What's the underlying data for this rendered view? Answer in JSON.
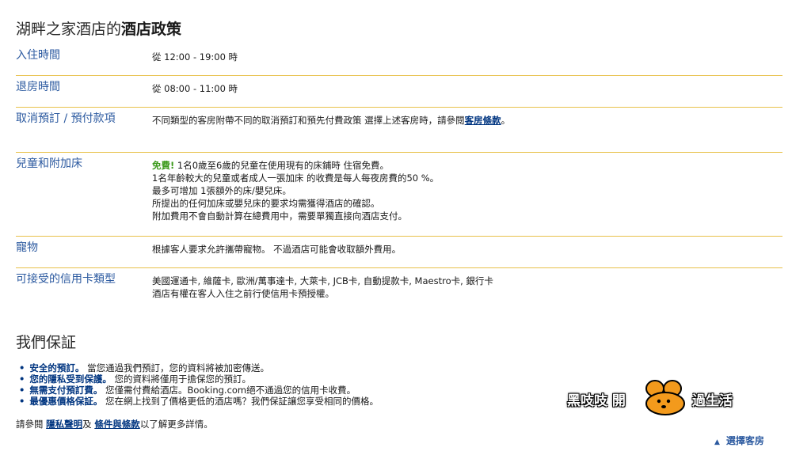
{
  "header": {
    "hotel_name": "湖畔之家酒店的",
    "title_bold": "酒店政策"
  },
  "policies": {
    "checkin": {
      "label": "入住時間",
      "value": "從 12:00 - 19:00 時"
    },
    "checkout": {
      "label": "退房時間",
      "value": "從 08:00 - 11:00 時"
    },
    "cancellation": {
      "label": "取消預訂 / 預付款項",
      "text": "不同類型的客房附帶不同的取消預訂和預先付費政策 選擇上述客房時，請參閱",
      "link": "客房條款",
      "suffix": "。"
    },
    "children": {
      "label": "兒童和附加床",
      "free": "免費!",
      "lines": [
        "1名0歲至6歲的兒童在使用現有的床鋪時 住宿免費。",
        "1名年齡較大的兒童或者成人一張加床 的收費是每人每夜房費的50 %。",
        "最多可增加 1張額外的床/嬰兒床。",
        "所提出的任何加床或嬰兒床的要求均需獲得酒店的確認。",
        "附加費用不會自動計算在總費用中，需要單獨直接向酒店支付。"
      ]
    },
    "pets": {
      "label": "寵物",
      "value": "根據客人要求允許攜帶寵物。 不過酒店可能會收取額外費用。"
    },
    "cards": {
      "label": "可接受的信用卡類型",
      "lines": [
        "美國運通卡, 維薩卡, 歐洲/萬事達卡, 大萊卡, JCB卡, 自動提款卡, Maestro卡, 銀行卡",
        "酒店有權在客人入住之前行使信用卡預授權。"
      ]
    }
  },
  "guarantee": {
    "title": "我們保証",
    "items": [
      {
        "bold": "安全的預訂。",
        "text": " 當您通過我們預訂，您的資料將被加密傳送。"
      },
      {
        "bold": "您的隱私受到保護。",
        "text": " 您的資料將僅用于擔保您的預訂。"
      },
      {
        "bold": "無需支付預訂費。",
        "text": " 您僅需付費給酒店。Booking.com絕不通過您的信用卡收費。"
      },
      {
        "bold": "最優惠價格保証。",
        "text": " 您在網上找到了價格更低的酒店嗎？我們保証讓您享受相同的價格。"
      }
    ]
  },
  "footer": {
    "prefix": "請參閱 ",
    "privacy_link": "隱私聲明",
    "mid": "及 ",
    "terms_link": "條件與條款",
    "suffix": "以了解更多詳情。",
    "choose_room": "選擇客房"
  },
  "watermark": {
    "left": "黑吱吱 開",
    "right": "過生活"
  },
  "colors": {
    "label_blue": "#2c5aa0",
    "link_blue": "#003580",
    "free_green": "#3c9a1c",
    "divider": "#e8c14a"
  }
}
